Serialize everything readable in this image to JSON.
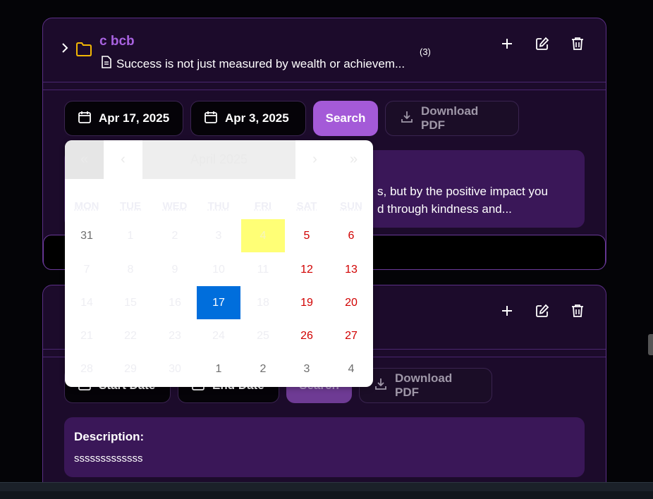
{
  "entry1": {
    "title": "c bcb",
    "description_preview": "Success is not just measured by wealth or achievem...",
    "count": "(3)",
    "start_date": "Apr 17, 2025",
    "end_date": "Apr 3, 2025",
    "search_label": "Search",
    "pdf_label": "Download PDF",
    "desc_line1": "s, but by the positive impact you",
    "desc_line2": "d through kindness and..."
  },
  "entry2": {
    "start_placeholder": "Start Date",
    "end_placeholder": "End Date",
    "search_label": "Search",
    "pdf_label": "Download PDF",
    "description_label": "Description:",
    "description_value": "sssssssssssss"
  },
  "calendar": {
    "nav_prev_year": "«",
    "nav_prev": "‹",
    "month_label": "April 2025",
    "nav_next": "›",
    "nav_next_year": "»",
    "weekdays": [
      "MON",
      "TUE",
      "WED",
      "THU",
      "FRI",
      "SAT",
      "SUN"
    ],
    "weeks": [
      [
        "31",
        "1",
        "2",
        "3",
        "4",
        "5",
        "6"
      ],
      [
        "7",
        "8",
        "9",
        "10",
        "11",
        "12",
        "13"
      ],
      [
        "14",
        "15",
        "16",
        "17",
        "18",
        "19",
        "20"
      ],
      [
        "21",
        "22",
        "23",
        "24",
        "25",
        "26",
        "27"
      ],
      [
        "28",
        "29",
        "30",
        "1",
        "2",
        "3",
        "4"
      ]
    ],
    "today_label": "4",
    "selected_label": "17"
  },
  "colors": {
    "accent": "#a45ad8",
    "title_purple": "#a862e0",
    "weekend_red": "#d10000",
    "selected_blue": "#006edc",
    "today_yellow": "#ffff76"
  }
}
